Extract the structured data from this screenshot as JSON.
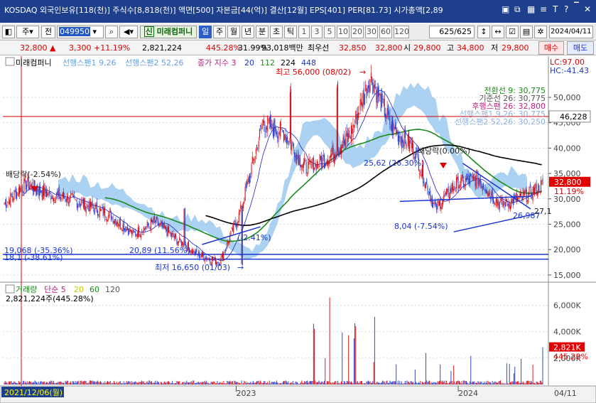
{
  "header": {
    "title": "KOSDAQ 외국인보유[118(천)] 주식수[8,818(천)] 액면[500] 자본금[44(억)] 결산[12월] EPS[401] PER[81.73] 시가총액[2,89"
  },
  "titlebar_icons": [
    "window-icon",
    "chart-icon",
    "grid-icon",
    "list-icon",
    "text-icon",
    "help-icon",
    "close-icon"
  ],
  "toolbar": {
    "market": "주",
    "period_label": "전",
    "code": "049950",
    "name": "미래컴퍼니",
    "name_badge": "신",
    "periods": [
      "일",
      "주",
      "월",
      "년",
      "분",
      "초",
      "틱"
    ],
    "selected_period": "일",
    "intervals": [
      "1",
      "3",
      "5",
      "10",
      "20",
      "30",
      "60",
      "120"
    ],
    "count": "625/625",
    "date": "2024/04/11"
  },
  "quote": {
    "price": "32,800",
    "change": "3,300",
    "change_pct": "+11.19%",
    "volume": "2,821,224",
    "volume_ratio": "445.28%",
    "turnover": "31.99%",
    "amount": "93,018백만",
    "best_ask_label": "최우선",
    "best_ask": "32,850",
    "best_bid": "32,800",
    "open_label": "시",
    "open": "29,800",
    "high_label": "고",
    "high": "34,800",
    "low_label": "저",
    "low": "29,800",
    "buy_label": "매수",
    "sell_label": "매도"
  },
  "legend": {
    "name": "미래컴퍼니",
    "span1": "선행스팬1 9,26",
    "span2": "선행스팬2 52,26",
    "close_label": "종가 지수 3",
    "ma": [
      "20",
      "112",
      "224",
      "448"
    ],
    "lc": "LC:97.00",
    "hc": "HC:-41.43"
  },
  "ichimoku_labels": [
    "전환선 9: 30,775",
    "기준선 26: 30,775",
    "후행스팬 26: 32,800",
    "선행스팬1 9,26: 30,775",
    "선행스팬2 52,26: 30,250"
  ],
  "annotations": {
    "max": "최고 56,000 (08/02)",
    "min": "최저 16,650 (01/03)",
    "div_left": "배당락(-2.54%)",
    "div_right": "배당락(0.00%)",
    "pct_mid": "25,62 (26.30%)",
    "pct_low": "8,04 (-7.54%)",
    "pct_left": "20,89 (11.56%)",
    "pct_left2": "(-2.41%)",
    "line_left1": "19,068 (-35.36%)",
    "line_left2": "18,1 (-38.61%)",
    "trend_end": "26,987",
    "trend_end2": "27,1"
  },
  "price_axis": [
    "50,000",
    "45,000",
    "40,000",
    "35,000",
    "30,000",
    "25,000",
    "20,000",
    "15,000"
  ],
  "price_tags": {
    "level": "46,228",
    "current": "32,800",
    "current_pct": "11.19%"
  },
  "volume_legend": {
    "title": "거래량",
    "ma_label": "단순 5",
    "ma": [
      "20",
      "60",
      "120"
    ],
    "value": "2,821,224주(445.28%)"
  },
  "volume_axis": [
    "6,000K",
    "4,000K",
    "2,000K"
  ],
  "volume_tags": {
    "current": "2,821K",
    "pct": "445.28%"
  },
  "date_axis": {
    "start": "2021/12/06(월)",
    "y2023": "2023",
    "y2024": "2024",
    "end": "04/11"
  },
  "colors": {
    "up": "#e00000",
    "down": "#1a35d0",
    "cloud": "#8fc3ee",
    "titlebar": "#1e3f8c"
  },
  "chart_data": {
    "type": "candlestick",
    "x_range": [
      "2021-12-06",
      "2024-04-11"
    ],
    "ylim": [
      14000,
      57000
    ],
    "max": {
      "value": 56000,
      "date": "2023-08-02"
    },
    "min": {
      "value": 16650,
      "date": "2023-01-03"
    },
    "last": {
      "open": 29800,
      "high": 34800,
      "low": 29800,
      "close": 32800,
      "volume": 2821224
    },
    "close_series": [
      [
        "2021-12",
        29000
      ],
      [
        "2022-01",
        33000
      ],
      [
        "2022-02",
        31000
      ],
      [
        "2022-03",
        30000
      ],
      [
        "2022-05",
        28500
      ],
      [
        "2022-07",
        26500
      ],
      [
        "2022-09",
        23000
      ],
      [
        "2022-10",
        25500
      ],
      [
        "2022-11",
        22000
      ],
      [
        "2022-12",
        19000
      ],
      [
        "2023-01",
        17500
      ],
      [
        "2023-02",
        28000
      ],
      [
        "2023-03",
        45000
      ],
      [
        "2023-04",
        43000
      ],
      [
        "2023-05",
        36000
      ],
      [
        "2023-06",
        38000
      ],
      [
        "2023-07",
        42000
      ],
      [
        "2023-08",
        54000
      ],
      [
        "2023-09",
        44000
      ],
      [
        "2023-10",
        40000
      ],
      [
        "2023-11",
        28000
      ],
      [
        "2023-12",
        33000
      ],
      [
        "2024-01",
        34000
      ],
      [
        "2024-02",
        29000
      ],
      [
        "2024-03",
        30000
      ],
      [
        "2024-04",
        32800
      ]
    ]
  }
}
